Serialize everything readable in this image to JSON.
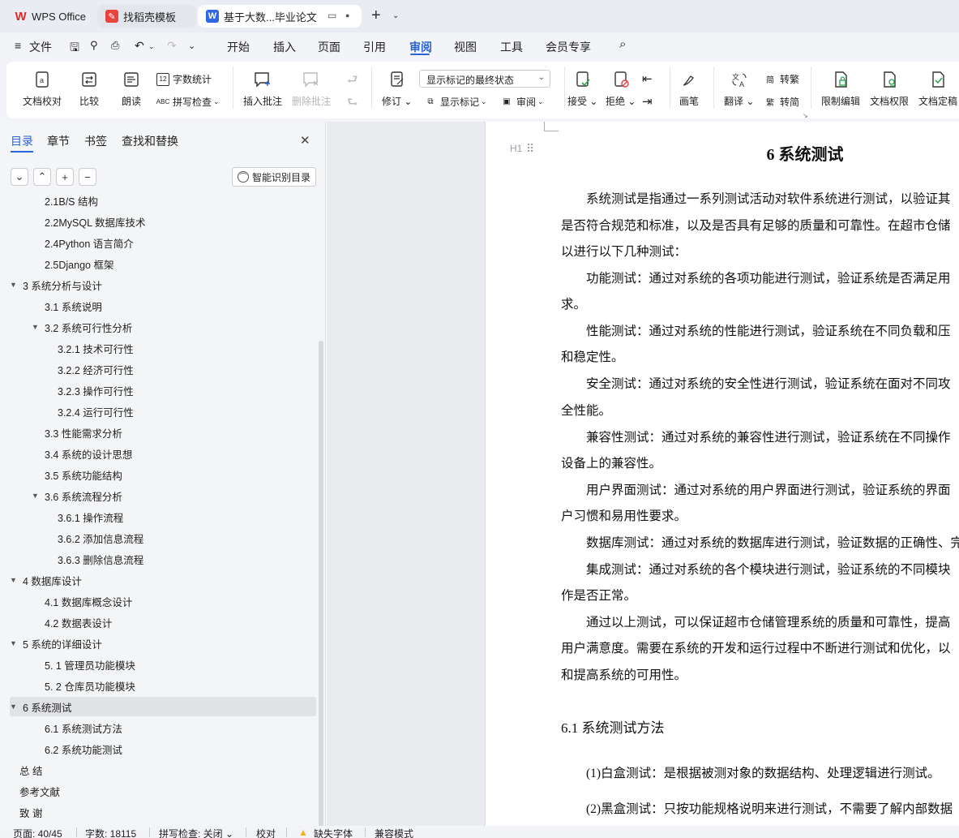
{
  "titlebar": {
    "tabs": [
      {
        "label": "WPS Office",
        "icon": "wps-logo-icon"
      },
      {
        "label": "找稻壳模板",
        "icon": "daoke-logo-icon"
      },
      {
        "label": "基于大数...毕业论文",
        "icon": "word-doc-icon"
      }
    ]
  },
  "menubar": {
    "file": "文件",
    "items": [
      "开始",
      "插入",
      "页面",
      "引用",
      "审阅",
      "视图",
      "工具",
      "会员专享"
    ],
    "active": "审阅"
  },
  "ribbon": {
    "proofread": "文档校对",
    "compare": "比较",
    "read_aloud": "朗读",
    "word_count": "字数统计",
    "spell_check": "拼写检查",
    "insert_comment": "插入批注",
    "delete_comment": "删除批注",
    "revise": "修订",
    "markup_mode": "显示标记的最终状态",
    "show_markup": "显示标记",
    "review": "审阅",
    "accept": "接受",
    "reject": "拒绝",
    "pen": "画笔",
    "translate": "翻译",
    "to_traditional": "转繁",
    "to_simplified": "转简",
    "restrict_edit": "限制编辑",
    "doc_permission": "文档权限",
    "doc_finalize": "文档定稿"
  },
  "sidepanel": {
    "tabs": [
      "目录",
      "章节",
      "书签",
      "查找和替换"
    ],
    "smart_toc": "智能识别目录",
    "toc": [
      {
        "label": "2.1B/S 结构",
        "level": 2
      },
      {
        "label": "2.2MySQL 数据库技术",
        "level": 2
      },
      {
        "label": "2.4Python 语言简介",
        "level": 2
      },
      {
        "label": "2.5Django 框架",
        "level": 2
      },
      {
        "label": "3  系统分析与设计",
        "level": 1,
        "expanded": true
      },
      {
        "label": "3.1 系统说明",
        "level": 2
      },
      {
        "label": "3.2 系统可行性分析",
        "level": 2,
        "expanded": true
      },
      {
        "label": "3.2.1  技术可行性",
        "level": 3
      },
      {
        "label": "3.2.2  经济可行性",
        "level": 3
      },
      {
        "label": "3.2.3 操作可行性",
        "level": 3
      },
      {
        "label": "3.2.4 运行可行性",
        "level": 3
      },
      {
        "label": "3.3  性能需求分析",
        "level": 2
      },
      {
        "label": "3.4 系统的设计思想",
        "level": 2
      },
      {
        "label": "3.5 系统功能结构",
        "level": 2
      },
      {
        "label": "3.6 系统流程分析",
        "level": 2,
        "expanded": true
      },
      {
        "label": "3.6.1 操作流程",
        "level": 3
      },
      {
        "label": "3.6.2 添加信息流程",
        "level": 3
      },
      {
        "label": "3.6.3 删除信息流程",
        "level": 3
      },
      {
        "label": "4  数据库设计",
        "level": 1,
        "expanded": true
      },
      {
        "label": "4.1 数据库概念设计",
        "level": 2
      },
      {
        "label": "4.2 数据表设计",
        "level": 2
      },
      {
        "label": "5  系统的详细设计",
        "level": 1,
        "expanded": true
      },
      {
        "label": "5. 1 管理员功能模块",
        "level": 2
      },
      {
        "label": "5. 2 仓库员功能模块",
        "level": 2
      },
      {
        "label": "6  系统测试",
        "level": 1,
        "expanded": true,
        "active": true
      },
      {
        "label": "6.1 系统测试方法",
        "level": 2
      },
      {
        "label": "6.2 系统功能测试",
        "level": 2
      },
      {
        "label": "总   结",
        "level": 1
      },
      {
        "label": "参考文献",
        "level": 1
      },
      {
        "label": "致   谢",
        "level": 1
      }
    ]
  },
  "document": {
    "heading_marker": "H1",
    "title": "6  系统测试",
    "lines": [
      "　　系统测试是指通过一系列测试活动对软件系统进行测试，以验证其",
      "是否符合规范和标准，以及是否具有足够的质量和可靠性。在超市仓储",
      "以进行以下几种测试：",
      "　　功能测试：通过对系统的各项功能进行测试，验证系统是否满足用",
      "求。",
      "　　性能测试：通过对系统的性能进行测试，验证系统在不同负载和压",
      "和稳定性。",
      "　　安全测试：通过对系统的安全性进行测试，验证系统在面对不同攻",
      "全性能。",
      "　　兼容性测试：通过对系统的兼容性进行测试，验证系统在不同操作",
      "设备上的兼容性。",
      "　　用户界面测试：通过对系统的用户界面进行测试，验证系统的界面",
      "户习惯和易用性要求。",
      "　　数据库测试：通过对系统的数据库进行测试，验证数据的正确性、完",
      "　　集成测试：通过对系统的各个模块进行测试，验证系统的不同模块",
      "作是否正常。",
      "　　通过以上测试，可以保证超市仓储管理系统的质量和可靠性，提高",
      "用户满意度。需要在系统的开发和运行过程中不断进行测试和优化，以",
      "和提高系统的可用性。"
    ],
    "section_title": "6.1 系统测试方法",
    "section_lines": [
      "　　(1)白盒测试：是根据被测对象的数据结构、处理逻辑进行测试。",
      "　　(2)黑盒测试：只按功能规格说明来进行测试，不需要了解内部数据"
    ]
  },
  "statusbar": {
    "page": "页面: 40/45",
    "words": "字数: 18115",
    "spell": "拼写检查: 关闭",
    "proof": "校对",
    "missing_font": "缺失字体",
    "compat": "兼容模式"
  },
  "colors": {
    "accent": "#2b63d8",
    "wps_red": "#e32a2a",
    "warning": "#f2b01e"
  }
}
